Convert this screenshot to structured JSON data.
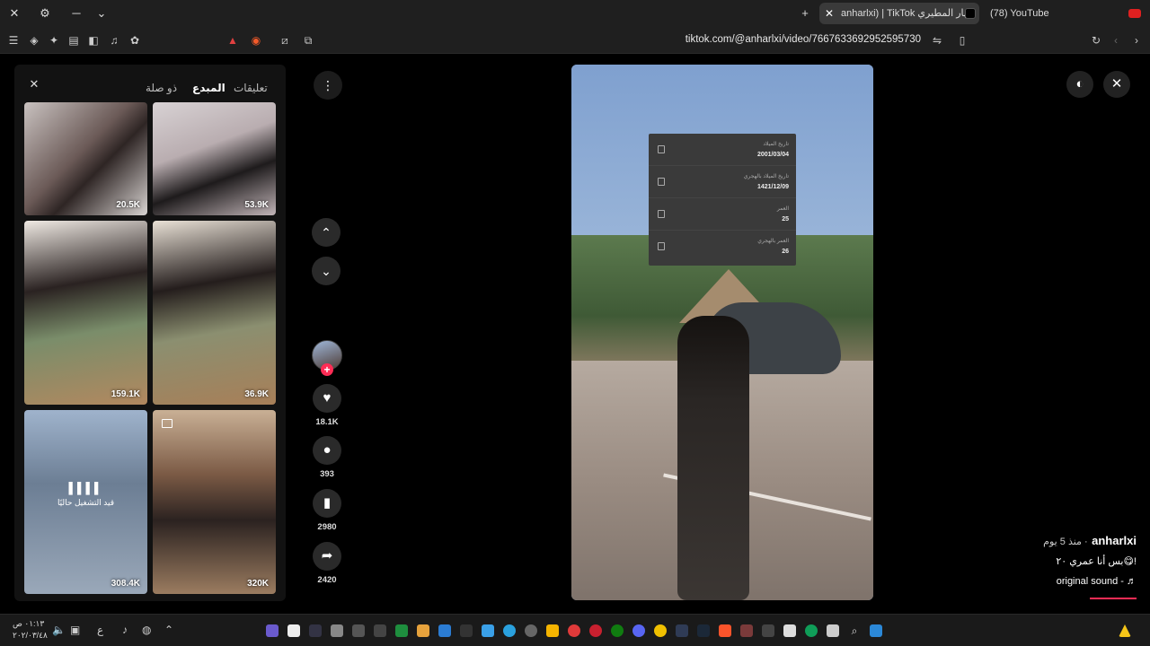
{
  "browser": {
    "tabs": [
      {
        "title": "anharlxi) | TikTok انهار المطيري",
        "active": true
      },
      {
        "title": "(78) YouTube",
        "active": false
      }
    ],
    "url": "tiktok.com/@anharlxi/video/7667633692952595730"
  },
  "panel": {
    "tabs": [
      "تعليقات",
      "المبدع",
      "ذو صلة"
    ],
    "active_tab": "المبدع",
    "videos": [
      {
        "views": "20.5K"
      },
      {
        "views": "53.9K"
      },
      {
        "views": "159.1K"
      },
      {
        "views": "36.9K"
      },
      {
        "views": "308.4K",
        "playing": true,
        "playing_label": "قيد التشغيل حاليًا"
      },
      {
        "views": "320K"
      }
    ]
  },
  "actions": {
    "likes": "18.1K",
    "comments": "393",
    "saves": "2980",
    "shares": "2420"
  },
  "overlay_card": {
    "rows": [
      {
        "label": "تاريخ الميلاد",
        "value": "2001/03/04"
      },
      {
        "label": "تاريخ الميلاد بالهجري",
        "value": "1421/12/09"
      },
      {
        "label": "العمر",
        "value": "25"
      },
      {
        "label": "العمر بالهجري",
        "value": "26"
      }
    ]
  },
  "description": {
    "username": "anharlxi",
    "posted": "منذ 5 يوم ·",
    "caption": "بس أنا عمري ٢٠😋!",
    "sound": "original sound - ♬"
  },
  "taskbar": {
    "time": "٠١:١٣ ص",
    "date": "٢٠٢/٠٣/٤٨"
  },
  "colors": {
    "accent": "#fe2c55",
    "bg": "#000000",
    "panel": "#121212"
  }
}
